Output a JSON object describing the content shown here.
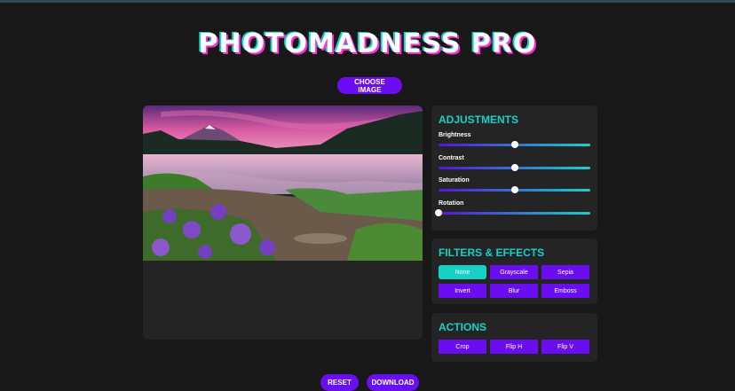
{
  "app": {
    "title": "PHOTOMADNESS PRO"
  },
  "header": {
    "choose_label": "CHOOSE IMAGE"
  },
  "adjustments": {
    "title": "ADJUSTMENTS",
    "sliders": [
      {
        "label": "Brightness",
        "value": 0.5
      },
      {
        "label": "Contrast",
        "value": 0.5
      },
      {
        "label": "Saturation",
        "value": 0.5
      },
      {
        "label": "Rotation",
        "value": 0.0
      }
    ]
  },
  "filters": {
    "title": "FILTERS & EFFECTS",
    "buttons": [
      {
        "label": "None",
        "active": true
      },
      {
        "label": "Grayscale",
        "active": false
      },
      {
        "label": "Sepia",
        "active": false
      },
      {
        "label": "Invert",
        "active": false
      },
      {
        "label": "Blur",
        "active": false
      },
      {
        "label": "Emboss",
        "active": false
      }
    ]
  },
  "actions": {
    "title": "ACTIONS",
    "buttons": [
      {
        "label": "Crop"
      },
      {
        "label": "Flip H"
      },
      {
        "label": "Flip V"
      }
    ]
  },
  "footer": {
    "reset_label": "RESET",
    "download_label": "DOWNLOAD"
  },
  "colors": {
    "accent": "#18d1c6",
    "button": "#6a0df0",
    "background": "#181818",
    "panel": "#242424"
  }
}
